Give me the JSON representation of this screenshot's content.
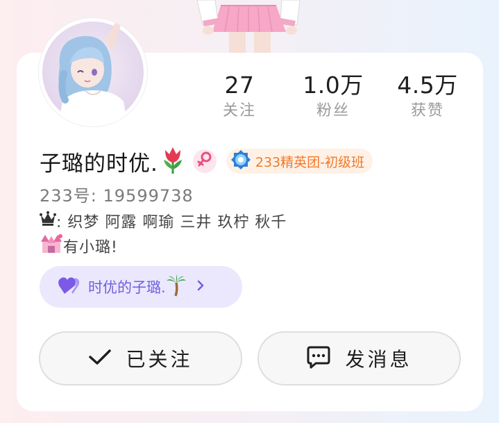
{
  "profile": {
    "username": "子璐的时优.",
    "uid_label": "233号: 19599738",
    "level_badge": "233精英团-初级班",
    "bio_line1": ": 织梦 阿露 啊瑜 三井 玖柠 秋千",
    "bio_line2": "有小璐!",
    "fan_group": "时优的子璐."
  },
  "stats": {
    "following": {
      "value": "27",
      "label": "关注"
    },
    "followers": {
      "value": "1.0万",
      "label": "粉丝"
    },
    "likes": {
      "value": "4.5万",
      "label": "获赞"
    }
  },
  "actions": {
    "follow_label": "已关注",
    "message_label": "发消息"
  },
  "colors": {
    "level_text": "#f07a2c",
    "level_bg": "#fff1e6",
    "fan_text": "#6f5fdf",
    "fan_bg": "#ebe8fd",
    "gender_bg": "#fde5ec",
    "gender_icon": "#e94f86"
  },
  "icons": {
    "tulip": "tulip-icon",
    "gender": "female-symbol-icon",
    "level": "blue-gem-medal-icon",
    "crown": "crown-icon",
    "castle": "castle-icon",
    "heart": "purple-heart-icon",
    "palm": "palm-tree-icon",
    "chevron": "chevron-right-icon",
    "check": "check-icon",
    "message": "chat-bubble-icon"
  }
}
